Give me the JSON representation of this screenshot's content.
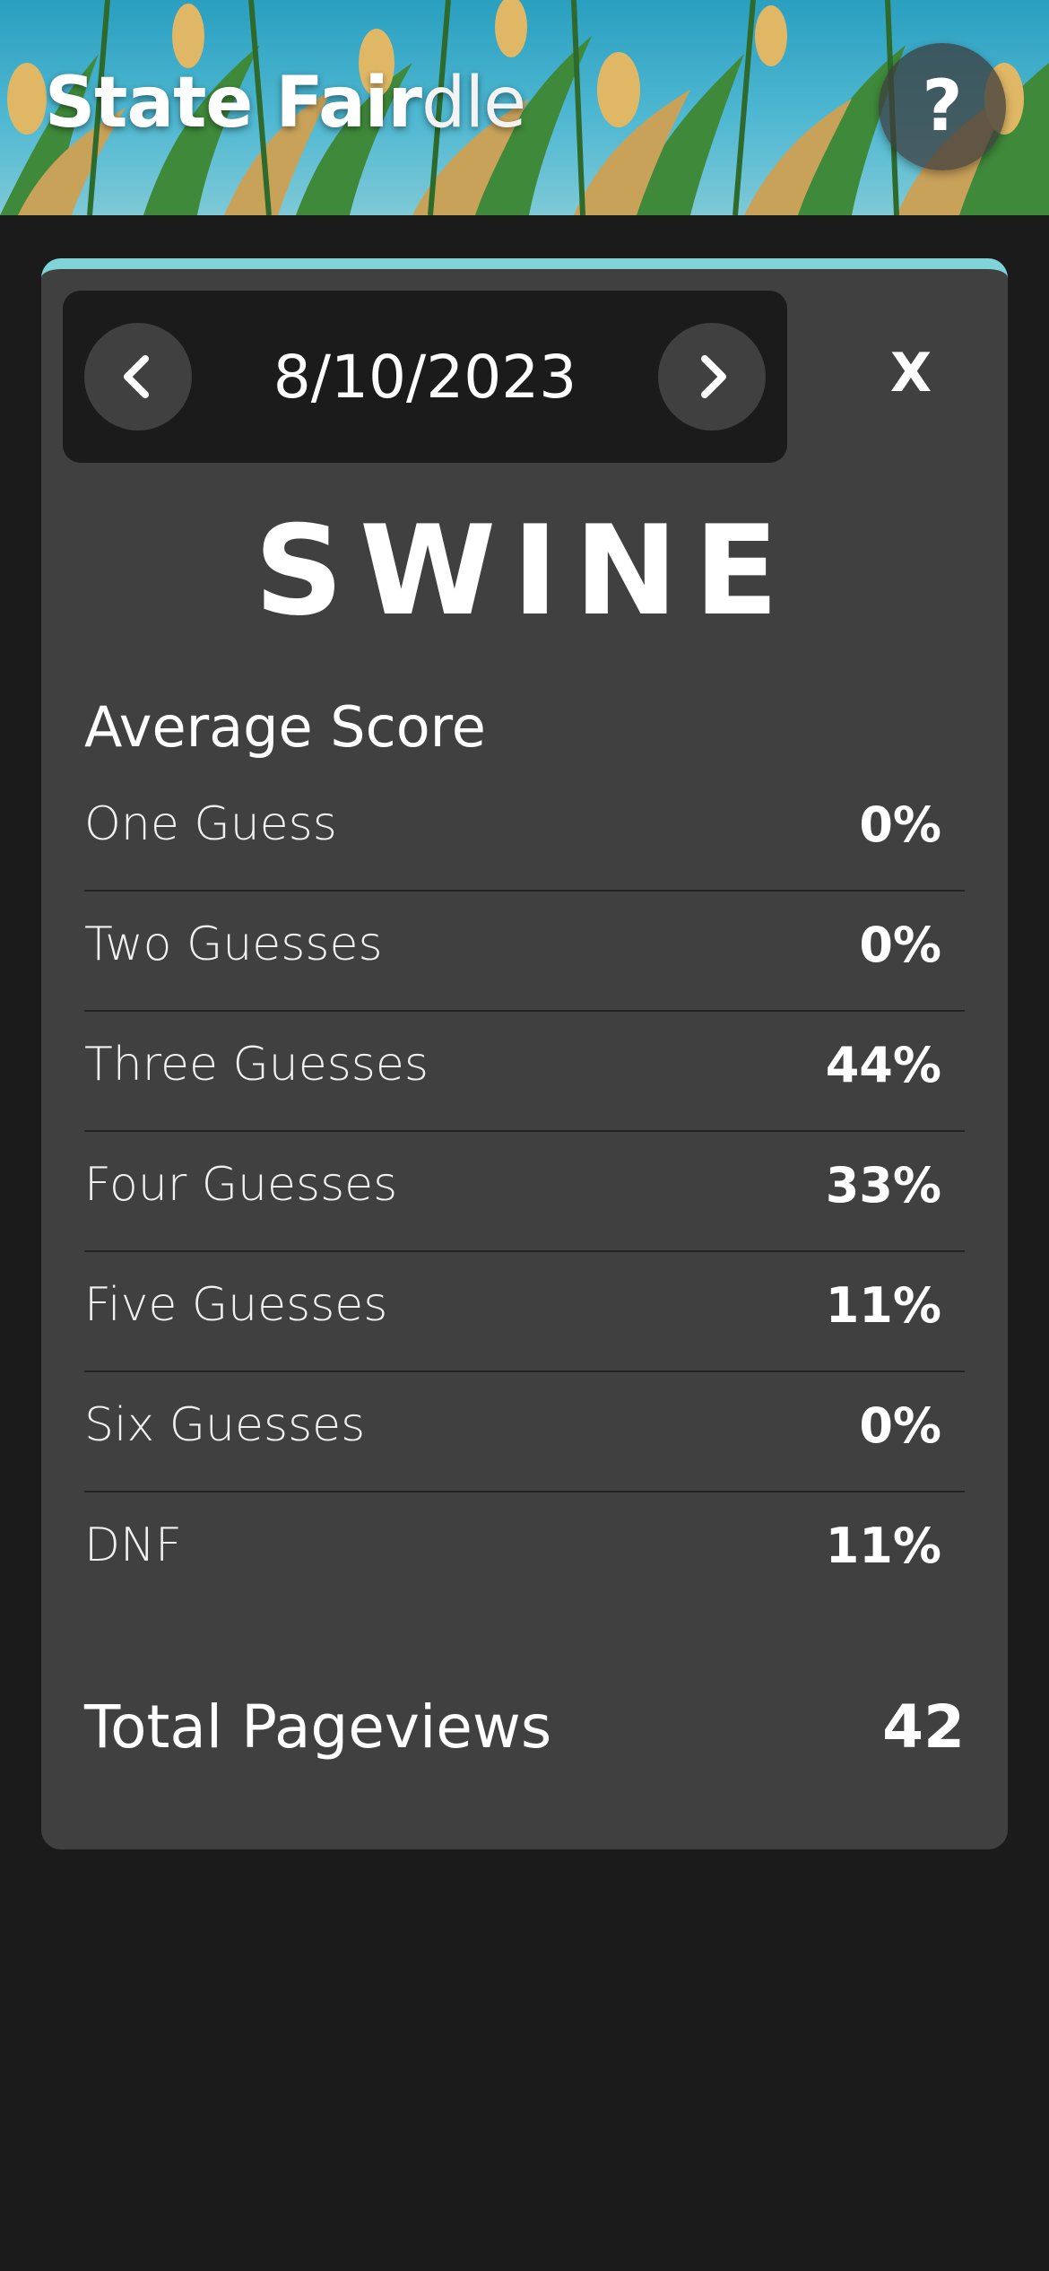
{
  "header": {
    "title_bold": "State Fair",
    "title_light": "dle",
    "help_label": "?"
  },
  "date_nav": {
    "date": "8/10/2023",
    "close_label": "X"
  },
  "word": "SWINE",
  "average_score": {
    "heading": "Average Score",
    "rows": [
      {
        "label": "One Guess",
        "value": "0%"
      },
      {
        "label": "Two Guesses",
        "value": "0%"
      },
      {
        "label": "Three Guesses",
        "value": "44%"
      },
      {
        "label": "Four Guesses",
        "value": "33%"
      },
      {
        "label": "Five Guesses",
        "value": "11%"
      },
      {
        "label": "Six Guesses",
        "value": "0%"
      },
      {
        "label": "DNF",
        "value": "11%"
      }
    ]
  },
  "total": {
    "label": "Total Pageviews",
    "value": "42"
  },
  "colors": {
    "background": "#1b1b1b",
    "card": "#404040",
    "accent": "#7fd3d9"
  }
}
